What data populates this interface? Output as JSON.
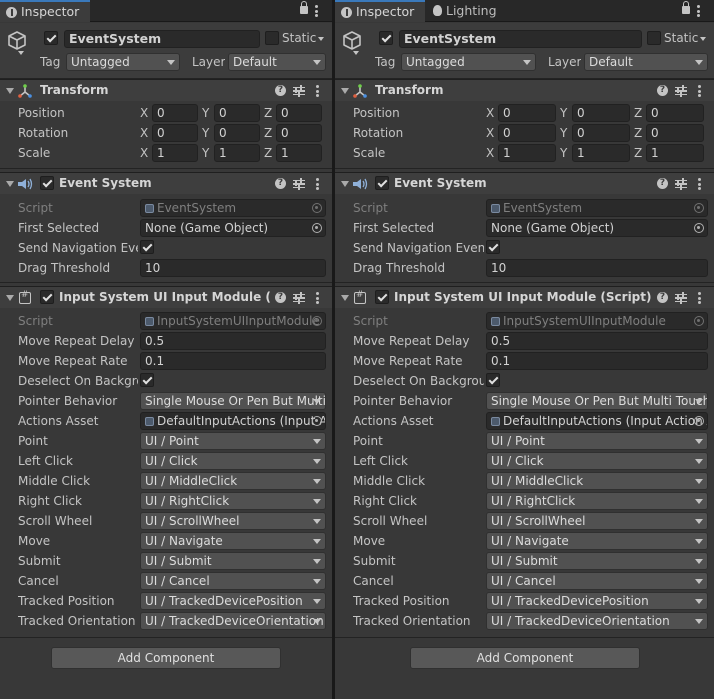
{
  "left": {
    "tabs": [
      {
        "label": "Inspector",
        "icon": "info-icon"
      }
    ],
    "header": {
      "object_name": "EventSystem",
      "static_label": "Static",
      "tag_label": "Tag",
      "tag_value": "Untagged",
      "layer_label": "Layer",
      "layer_value": "Default"
    },
    "transform": {
      "title": "Transform",
      "position_label": "Position",
      "rotation_label": "Rotation",
      "scale_label": "Scale",
      "position": {
        "x": "0",
        "y": "0",
        "z": "0"
      },
      "rotation": {
        "x": "0",
        "y": "0",
        "z": "0"
      },
      "scale": {
        "x": "1",
        "y": "1",
        "z": "1"
      }
    },
    "event_system": {
      "title": "Event System",
      "script_label": "Script",
      "script_value": "EventSystem",
      "first_selected_label": "First Selected",
      "first_selected_value": "None (Game Object)",
      "send_nav_label": "Send Navigation Events",
      "drag_threshold_label": "Drag Threshold",
      "drag_threshold_value": "10"
    },
    "input_module": {
      "title": "Input System UI Input Module (Script)",
      "script_label": "Script",
      "script_value": "InputSystemUIInputModule",
      "rows": [
        {
          "label": "Move Repeat Delay",
          "value": "0.5",
          "kind": "text"
        },
        {
          "label": "Move Repeat Rate",
          "value": "0.1",
          "kind": "text"
        },
        {
          "label": "Deselect On Background Click",
          "value": "",
          "kind": "check"
        },
        {
          "label": "Pointer Behavior",
          "value": "Single Mouse Or Pen But Multi Touch And Track",
          "kind": "dropdown"
        },
        {
          "label": "Actions Asset",
          "value": "DefaultInputActions (Input Action Asset)",
          "kind": "object"
        },
        {
          "label": "Point",
          "value": "UI / Point",
          "kind": "dropdown"
        },
        {
          "label": "Left Click",
          "value": "UI / Click",
          "kind": "dropdown"
        },
        {
          "label": "Middle Click",
          "value": "UI / MiddleClick",
          "kind": "dropdown"
        },
        {
          "label": "Right Click",
          "value": "UI / RightClick",
          "kind": "dropdown"
        },
        {
          "label": "Scroll Wheel",
          "value": "UI / ScrollWheel",
          "kind": "dropdown"
        },
        {
          "label": "Move",
          "value": "UI / Navigate",
          "kind": "dropdown"
        },
        {
          "label": "Submit",
          "value": "UI / Submit",
          "kind": "dropdown"
        },
        {
          "label": "Cancel",
          "value": "UI / Cancel",
          "kind": "dropdown"
        },
        {
          "label": "Tracked Position",
          "value": "UI / TrackedDevicePosition",
          "kind": "dropdown"
        },
        {
          "label": "Tracked Orientation",
          "value": "UI / TrackedDeviceOrientation",
          "kind": "dropdown"
        }
      ]
    },
    "add_component": "Add Component"
  },
  "right": {
    "tabs": [
      {
        "label": "Inspector",
        "icon": "info-icon"
      },
      {
        "label": "Lighting",
        "icon": "lightbulb-icon"
      }
    ],
    "header": {
      "object_name": "EventSystem",
      "static_label": "Static",
      "tag_label": "Tag",
      "tag_value": "Untagged",
      "layer_label": "Layer",
      "layer_value": "Default"
    },
    "transform": {
      "title": "Transform",
      "position_label": "Position",
      "rotation_label": "Rotation",
      "scale_label": "Scale",
      "position": {
        "x": "0",
        "y": "0",
        "z": "0"
      },
      "rotation": {
        "x": "0",
        "y": "0",
        "z": "0"
      },
      "scale": {
        "x": "1",
        "y": "1",
        "z": "1"
      }
    },
    "event_system": {
      "title": "Event System",
      "script_label": "Script",
      "script_value": "EventSystem",
      "first_selected_label": "First Selected",
      "first_selected_value": "None (Game Object)",
      "send_nav_label": "Send Navigation Events",
      "drag_threshold_label": "Drag Threshold",
      "drag_threshold_value": "10"
    },
    "input_module": {
      "title": "Input System UI Input Module (Script)",
      "script_label": "Script",
      "script_value": "InputSystemUIInputModule",
      "rows": [
        {
          "label": "Move Repeat Delay",
          "value": "0.5",
          "kind": "text"
        },
        {
          "label": "Move Repeat Rate",
          "value": "0.1",
          "kind": "text"
        },
        {
          "label": "Deselect On Background Click",
          "value": "",
          "kind": "check"
        },
        {
          "label": "Pointer Behavior",
          "value": "Single Mouse Or Pen But Multi Touch And Track",
          "kind": "dropdown"
        },
        {
          "label": "Actions Asset",
          "value": "DefaultInputActions (Input Action Asset)",
          "kind": "object"
        },
        {
          "label": "Point",
          "value": "UI / Point",
          "kind": "dropdown"
        },
        {
          "label": "Left Click",
          "value": "UI / Click",
          "kind": "dropdown"
        },
        {
          "label": "Middle Click",
          "value": "UI / MiddleClick",
          "kind": "dropdown"
        },
        {
          "label": "Right Click",
          "value": "UI / RightClick",
          "kind": "dropdown"
        },
        {
          "label": "Scroll Wheel",
          "value": "UI / ScrollWheel",
          "kind": "dropdown"
        },
        {
          "label": "Move",
          "value": "UI / Navigate",
          "kind": "dropdown"
        },
        {
          "label": "Submit",
          "value": "UI / Submit",
          "kind": "dropdown"
        },
        {
          "label": "Cancel",
          "value": "UI / Cancel",
          "kind": "dropdown"
        },
        {
          "label": "Tracked Position",
          "value": "UI / TrackedDevicePosition",
          "kind": "dropdown"
        },
        {
          "label": "Tracked Orientation",
          "value": "UI / TrackedDeviceOrientation",
          "kind": "dropdown"
        }
      ]
    },
    "add_component": "Add Component"
  },
  "axes": {
    "x": "X",
    "y": "Y",
    "z": "Z"
  },
  "colors": {
    "background": "#383838",
    "tab_accent": "#3a79bb",
    "field": "#2a2a2a",
    "dropdown": "#515151"
  }
}
